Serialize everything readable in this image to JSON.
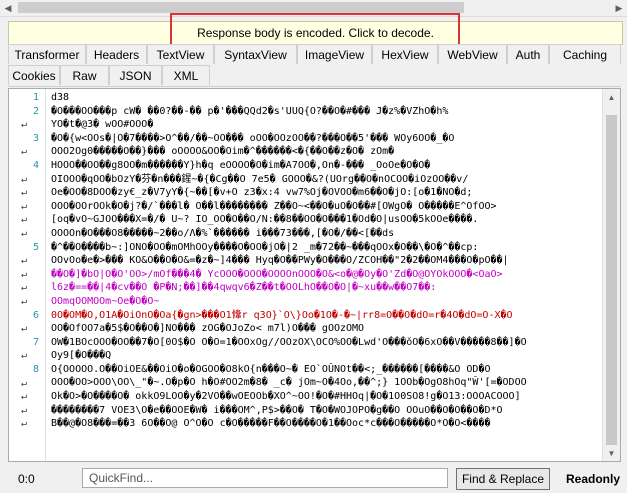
{
  "banner": {
    "text": "Response body is encoded. Click to decode."
  },
  "tabs_row1": [
    {
      "label": "Transformer",
      "active": false
    },
    {
      "label": "Headers",
      "active": false
    },
    {
      "label": "TextView",
      "active": false
    },
    {
      "label": "SyntaxView",
      "active": false
    },
    {
      "label": "ImageView",
      "active": false
    },
    {
      "label": "HexView",
      "active": false
    },
    {
      "label": "WebView",
      "active": false
    },
    {
      "label": "Auth",
      "active": false
    },
    {
      "label": "Caching",
      "active": false
    }
  ],
  "tabs_row2": [
    {
      "label": "Cookies",
      "active": false
    },
    {
      "label": "Raw",
      "active": false
    },
    {
      "label": "JSON",
      "active": false
    },
    {
      "label": "XML",
      "active": false
    }
  ],
  "editor": {
    "lines": [
      {
        "gutter": "1",
        "text": "d38"
      },
      {
        "gutter": "2",
        "text": "�O���OO���p cW� ��0?��-�� p�'���QQd2�s'UUQ{O?��O�#���  J�z%�VZhO�h%"
      },
      {
        "gutter": "wrap",
        "text": "YO�t�@3� wOO#OOO�"
      },
      {
        "gutter": "3",
        "text": "�O�{w<OOs�|O�7����>O^��/��~OO���   oOO�OOzOO��?���O��5'���  WOy6OO�_�O"
      },
      {
        "gutter": "wrap",
        "text": "OOO2Og0�����O��}���  oOOOO&OO�Oim�^������<�{��O��z�O� zOm�"
      },
      {
        "gutter": "4",
        "text": "HOOO��OO��g8OO�m������Y}h�q  eOOOO�O�im�A7OO�,On�-���  _OoOe�O�O�"
      },
      {
        "gutter": "wrap",
        "text": "OIOOO�qOO�bOzY�芬�n���鍟~�{�Cg��O 7e5�  GOOO�&?(UOrg��O�nOCOO�iOzOO��v/"
      },
      {
        "gutter": "wrap",
        "text": "Oe�OO�8DOO�zy€_z�V7yY�{~��[�v+O  z3�x:4  vw7%Oj�OVOO�m6��O�jO:[o�1�NO�d;"
      },
      {
        "gutter": "wrap",
        "text": "OOO�OOrOOk�O�j?�/`���l� O��l��������     Z��O~<��O�uO�O��#[OWgO�     O�����E^OfOO>"
      },
      {
        "gutter": "wrap",
        "text": "[oq�vO~GJOO���X=�/� U~? IO_OO�O��O/N:��8��OO�O���1�Od�O|usOO�5kOOe����."
      },
      {
        "gutter": "wrap",
        "text": "OOOOn�O���O8�����~2��o/Λ�%`������    i���73���,[�O�/��<[��ds"
      },
      {
        "gutter": "5",
        "text": "�^��O����b~:]ONO�OO�mOMhOOy����O�OO�jO�|2 _m�72��~���qOOx�O��\\�O�^��cp:"
      },
      {
        "gutter": "wrap",
        "text": "OOvOo�e�>��� KO&O��O�O&=�z�~]4���  Hyq�O��PWy�O���O/ZCOH��\"2�2��OM4���O�pO��|"
      },
      {
        "gutter": "wrap",
        "text": "��O�]�bO|O�O'OO>/mOf���4�  YcOOO�OOO�OOOOnOOO�O&<o�@�Oy�O'Zd�O@OYOkOOO�<OaO>"
      },
      {
        "gutter": "wrap",
        "text": "l6z�==��|4�cv��O   �P�N;��]��4qwqv6�Z��t�OOLhO��O�O|�~xu��w��O7��:"
      },
      {
        "gutter": "wrap",
        "text": "OOmqOOMOOm~Oe�O�O~"
      },
      {
        "gutter": "6",
        "text": "0O�OM�O,O1A�OiOnO�Oa{�gn>���O1鞗r q3O}`O\\}Oo�1O�-�~|rr8=O��O�dO=r�4O�dO=O-X�O"
      },
      {
        "gutter": "wrap",
        "text": "OO�OfOO7a�5$�O��O�]NO���  zOG�OJoZo< m7l)O��� gOOzOMO"
      },
      {
        "gutter": "7",
        "text": "OW�1BOcOOO�OO��7�O[0O$�O   O�O=1�OOxOg//OOzOX\\OCO%OO�Lwd'O���ŏO�6xO��V�����8��]�O"
      },
      {
        "gutter": "wrap",
        "text": "Oy9[�O���Q"
      },
      {
        "gutter": "8",
        "text": "O{OOOOO.O��OiOE&��OiO�o�OGOO�O8kO{n���O~� EO`OÛNOt��<;_������[����&O  OD�O"
      },
      {
        "gutter": "wrap",
        "text": "OOO�OO>OOO\\OO\\_\"�~.O�p�O h�O#OO2m�8�  _c� jOm~O�4Oo,��^;}   1OOb�OgO8hOq\"Ŵ'[=�ODOO"
      },
      {
        "gutter": "wrap",
        "text": "Ok�O>�O����O� okkO9LOO�y�2VO��wOEOOb�XO^~OO!�O�#HHOq|�O�1O0SO8!g�O13:OOOACOOO]"
      },
      {
        "gutter": "wrap",
        "text": "��������7  VOE3\\O�e��OOE�W� i���OM^,P$>��O� T�O�WOJOPO�g��O   OOuO��O�O��O�D*O"
      },
      {
        "gutter": "wrap",
        "text": "B��@�O8���=��3 6O��O@ O^O�O    c�O�����F��O����O�1��Ooc*c���O�����O*O�O<����"
      }
    ]
  },
  "status": {
    "position": "0:0",
    "quickfind_placeholder": "QuickFind...",
    "find_replace_label": "Find & Replace",
    "readonly_label": "Readonly"
  },
  "icons": {
    "scroll_left": "chevron-left-icon",
    "scroll_right": "chevron-right-icon",
    "scroll_up": "chevron-up-icon",
    "scroll_down": "chevron-down-icon",
    "wrap": "word-wrap-icon"
  },
  "colors": {
    "highlight_border": "#e0303a",
    "banner_bg": "#ffffe1",
    "line_number": "#2b91af"
  }
}
